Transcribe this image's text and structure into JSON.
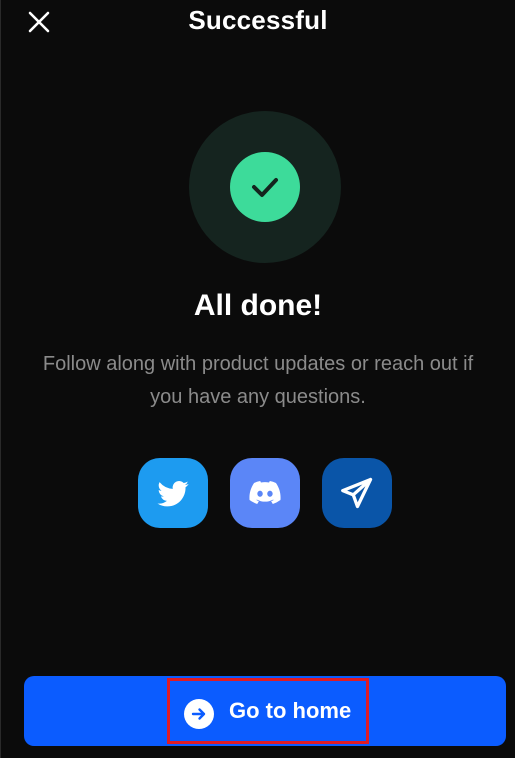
{
  "header": {
    "title": "Successful",
    "close_icon": "close-icon"
  },
  "status": {
    "icon": "checkmark-icon",
    "headline": "All done!",
    "message": "Follow along with product updates or reach out if you have any questions."
  },
  "socials": [
    {
      "name": "twitter-icon",
      "color": "#1d9bf0"
    },
    {
      "name": "discord-icon",
      "color": "#5b86f7"
    },
    {
      "name": "telegram-icon",
      "color": "#0a55a8"
    }
  ],
  "footer": {
    "home_label": "Go to home",
    "home_icon": "arrow-right-icon"
  },
  "colors": {
    "background": "#0b0b0b",
    "primary": "#0b5cff",
    "success": "#3ddb9a",
    "highlight": "#e01b24"
  }
}
